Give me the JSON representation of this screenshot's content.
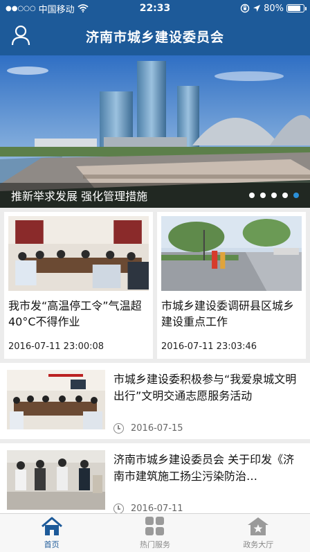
{
  "status_bar": {
    "signal": "●●○○○",
    "carrier": "中国移动",
    "time": "22:33",
    "battery": "80%"
  },
  "header": {
    "title": "济南市城乡建设委员会"
  },
  "banner": {
    "caption": "推新举求发展 强化管理措施",
    "page_count": 5,
    "active_page": 5
  },
  "featured": [
    {
      "title": "我市发“高温停工令”气温超40°C不得作业",
      "date": "2016-07-11 23:00:08"
    },
    {
      "title": "市城乡建设委调研县区城乡建设重点工作",
      "date": "2016-07-11 23:03:46"
    }
  ],
  "news": [
    {
      "title": "市城乡建设委积极参与“我爱泉城文明出行”文明交通志愿服务活动",
      "date": "2016-07-15"
    },
    {
      "title": "济南市城乡建设委员会 关于印发《济南市建筑施工扬尘污染防治…",
      "date": "2016-07-11"
    }
  ],
  "tabbar": {
    "items": [
      {
        "label": "首页",
        "icon": "home-icon"
      },
      {
        "label": "热门服务",
        "icon": "grid-icon"
      },
      {
        "label": "政务大厅",
        "icon": "hall-icon"
      }
    ]
  },
  "colors": {
    "brand": "#1d5a99",
    "pager_active": "#2b8fd8"
  }
}
